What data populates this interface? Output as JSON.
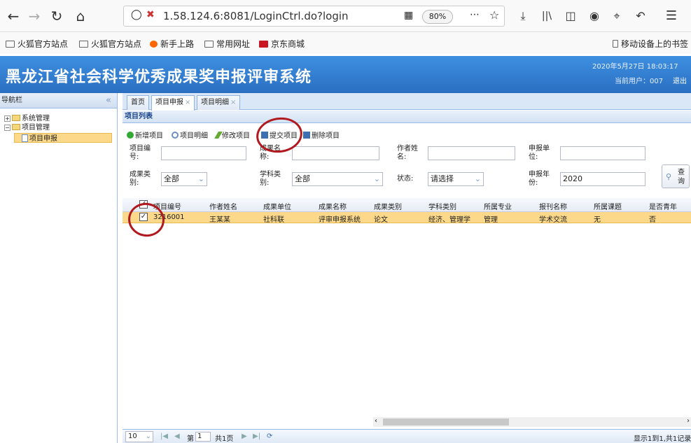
{
  "browser": {
    "url": "1.58.124.6:8081/LoginCtrl.do?login",
    "zoom": "80%",
    "bookmarks": [
      "火狐官方站点",
      "火狐官方站点",
      "新手上路",
      "常用网址",
      "京东商城"
    ],
    "mobile_bookmarks": "移动设备上的书签"
  },
  "header": {
    "title": "黑龙江省社会科学优秀成果奖申报评审系统",
    "datetime": "2020年5月27日 18:03:17",
    "user": "当前用户：007",
    "logout": "退出"
  },
  "nav": {
    "title": "导航栏",
    "collapse": "«",
    "items": [
      "系统管理",
      "项目管理",
      "项目申报"
    ]
  },
  "tabs": [
    "首页",
    "项目申报",
    "项目明细"
  ],
  "panel": {
    "title": "项目列表",
    "toolbar": [
      "新增项目",
      "项目明细",
      "修改项目",
      "提交项目",
      "删除项目"
    ]
  },
  "filters": {
    "project_no": "项目编号:",
    "result_name": "成果名称:",
    "author_name": "作者姓名:",
    "unit": "申报单位:",
    "result_type": "成果类别:",
    "result_type_value": "全部",
    "subject_type": "学科类别:",
    "subject_type_value": "全部",
    "status": "状态:",
    "status_value": "请选择",
    "year": "申报年份:",
    "year_value": "2020",
    "query": "查询"
  },
  "grid": {
    "columns": [
      "项目编号",
      "作者姓名",
      "成果单位",
      "成果名称",
      "成果类别",
      "学科类别",
      "所属专业",
      "报刊名称",
      "所属课题",
      "是否青年"
    ],
    "rows": [
      [
        "3216001",
        "王某某",
        "社科联",
        "评审申报系统",
        "论文",
        "经济、管理学",
        "管理",
        "学术交流",
        "无",
        "否"
      ]
    ]
  },
  "pager": {
    "page_size": "10",
    "page_label": "第",
    "page_no": "1",
    "total_pages": "共1页",
    "summary": "显示1到1,共1记录"
  },
  "colors": {
    "header_blue": "#2a6fc2",
    "selected_row": "#fcd98a",
    "annotation": "#b0191e"
  }
}
